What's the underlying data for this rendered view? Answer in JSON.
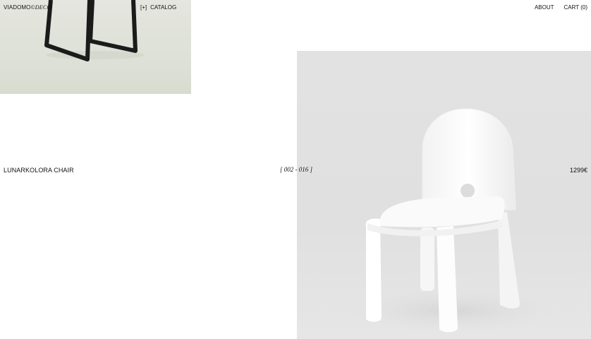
{
  "header": {
    "brand_primary": "VIADOMO",
    "brand_secondary": "©DECO",
    "catalog_toggle": "[+]",
    "catalog_label": "CATALOG",
    "about_label": "ABOUT",
    "cart_label": "CART (0)"
  },
  "product": {
    "name": "LUNARKOLORA CHAIR",
    "counter": "[ 002 - 016 ]",
    "price": "1299€"
  },
  "colors": {
    "background": "#ffffff",
    "text": "#111111",
    "photo_backdrop": "#e0e0e0"
  }
}
